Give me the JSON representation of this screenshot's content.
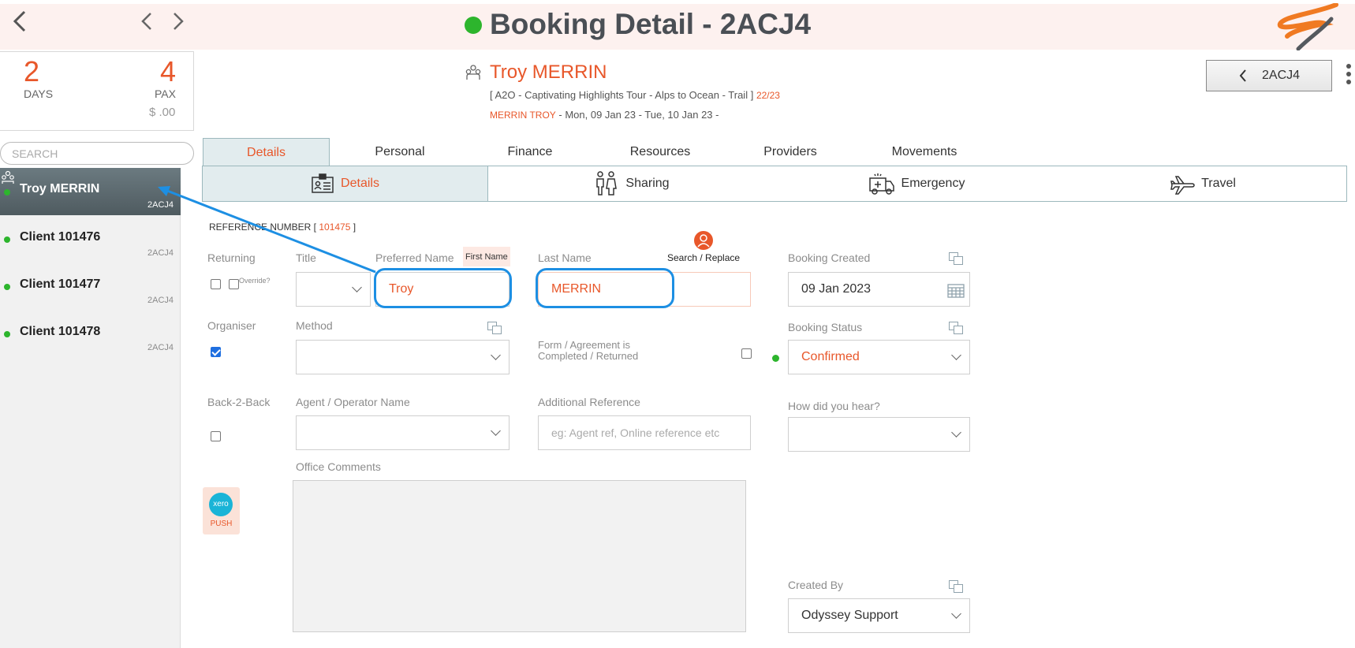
{
  "header": {
    "title": "Booking Detail - 2ACJ4",
    "status_color": "#2db52d",
    "back_icon": "chevron-left-icon",
    "prev_icon": "chevron-left-icon",
    "next_icon": "chevron-right-icon"
  },
  "summary": {
    "days_value": "2",
    "days_label": "DAYS",
    "pax_value": "4",
    "pax_label": "PAX",
    "amount": "$ .00"
  },
  "search": {
    "placeholder": "SEARCH"
  },
  "clients": [
    {
      "name": "Troy MERRIN",
      "code": "2ACJ4",
      "active": true
    },
    {
      "name": "Client 101476",
      "code": "2ACJ4"
    },
    {
      "name": "Client 101477",
      "code": "2ACJ4"
    },
    {
      "name": "Client 101478",
      "code": "2ACJ4"
    }
  ],
  "booking": {
    "client_name": "Troy MERRIN",
    "tour_text": "[ A2O - Captivating Highlights Tour - Alps to Ocean - Trail ]",
    "tour_code": "22/23",
    "lead_name": "MERRIN TROY",
    "dates": " - Mon, 09 Jan 23 - Tue, 10 Jan 23 -",
    "nav_button": "2ACJ4"
  },
  "tabs": [
    "Details",
    "Personal",
    "Finance",
    "Resources",
    "Providers",
    "Movements"
  ],
  "subtabs": [
    "Details",
    "Sharing",
    "Emergency",
    "Travel"
  ],
  "form": {
    "reference_prefix": "REFERENCE NUMBER [",
    "reference_number": "101475",
    "reference_suffix": "]",
    "returning_label": "Returning",
    "override_label": "Override?",
    "title_label": "Title",
    "preferred_name_label": "Preferred Name",
    "first_name_tag": "First Name",
    "preferred_name_value": "Troy",
    "last_name_label": "Last Name",
    "last_name_value": "MERRIN",
    "search_replace_label": "Search / Replace",
    "booking_created_label": "Booking Created",
    "booking_created_value": "09 Jan 2023",
    "organiser_label": "Organiser",
    "method_label": "Method",
    "form_agreement_label_1": "Form / Agreement is",
    "form_agreement_label_2": "Completed / Returned",
    "booking_status_label": "Booking Status",
    "booking_status_value": "Confirmed",
    "back2back_label": "Back-2-Back",
    "agent_label": "Agent / Operator Name",
    "additional_ref_label": "Additional Reference",
    "additional_ref_placeholder": "eg: Agent ref, Online reference etc",
    "how_hear_label": "How did you hear?",
    "office_comments_label": "Office Comments",
    "created_by_label": "Created By",
    "created_by_value": "Odyssey Support",
    "xero_logo_text": "xero",
    "xero_push_label": "PUSH"
  },
  "colors": {
    "accent": "#e8572a",
    "highlight": "#1d8fe3",
    "tab_active_bg": "#e2ecee"
  }
}
